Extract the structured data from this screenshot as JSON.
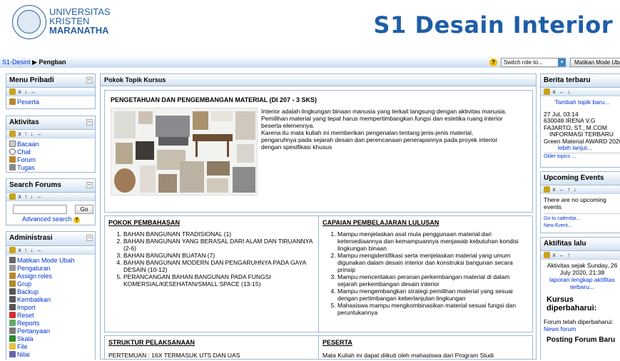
{
  "header": {
    "uni_line1": "UNIVERSITAS",
    "uni_line2": "KRISTEN",
    "uni_line3": "MARANATHA",
    "site_title": "S1 Desain Interior"
  },
  "breadcrumb": {
    "home": "S1-Desint",
    "arrow": "▶",
    "current": "Pengban"
  },
  "nav": {
    "help": "?",
    "role_select": "Switch role to...",
    "edit_button": "Matikan Mode Ubah"
  },
  "left": {
    "menu_pribadi": {
      "title": "Menu Pribadi",
      "items": [
        "Peserta"
      ]
    },
    "aktivitas": {
      "title": "Aktivitas",
      "items": [
        "Bacaan",
        "Chat",
        "Forum",
        "Tugas"
      ]
    },
    "search": {
      "title": "Search Forums",
      "button": "Go",
      "advanced": "Advanced search"
    },
    "admin": {
      "title": "Administrasi",
      "items": [
        "Matikan Mode Ubah",
        "Pengaturan",
        "Assign roles",
        "Grup",
        "Backup",
        "Kembalikan",
        "Import",
        "Reset",
        "Reports",
        "Pertanyaan",
        "Skala",
        "File",
        "Nilai"
      ]
    }
  },
  "content": {
    "header": "Pokok Topik Kursus",
    "summary_title": "PENGETAHUAN DAN PENGEMBANGAN MATERIAL (DI 207 - 3 SKS)",
    "description": [
      "Interior adalah lingkungan binaan manusia yang terkait langsung dengan aktivitas manusia.",
      "Pemilihan material yang tepat harus mempertimbangkan fungsi dan estetika ruang interior beserta elemennya.",
      "Karena itu mata kuliah ini memberikan pengenalan tentang jenis-jenis material, pengaruhnya pada sejarah desain dan perencanaan penerapannya pada proyek interior dengan spesifikasi khusus"
    ],
    "pokok_title": "POKOK PEMBAHASAN",
    "pokok_items": [
      "BAHAN BANGUNAN TRADISIONAL (1)",
      "BAHAN BANGUNAN YANG BERASAL DARI ALAM DAN TIRUANNYA (2-6)",
      "BAHAN BANGUNAN BUATAN (7)",
      "BAHAN BANGUNAN MODERN DAN PENGARUHNYA PADA GAYA DESAIN (10-12)",
      "PERANCANGAN BAHAN BANGUNAN PADA FUNGSI KOMERSIAL/KESEHATAN/SMALL SPACE (13-15)"
    ],
    "capaian_title": "CAPAIAN PEMBELAJARAN LULUSAN",
    "capaian_items": [
      "Mampu menjelaskan asal mula penggunaan material dari ketersediaannya dan kemampuannya menjawab kebutuhan kondisi lingkungan binaan",
      "Mampu mengidentifikasi serta menjelaskan material yang umum digunakan dalam desain interior dan konstruksi bangunan secara prinsip",
      "Mampu menceritakan peranan perkembangan material di dalam sejarah perkembangan desain interior",
      "Mampu mengembangkan strategi pemilihan material yang sesuai dengan pertimbangan keberlanjutan lingkungan",
      "Mahasiswa mampu mengkombinasikan material sesuai fungsi dan peruntukannya"
    ],
    "struktur_title": "STRUKTUR PELAKSANAAN",
    "struktur_text": "PERTEMUAN : 16X TERMASUK UTS DAN UAS",
    "peserta_title": "PESERTA",
    "peserta_text": "Mata Kuliah ini dapat diikuti oleh mahasiswa dari Program Studi"
  },
  "right": {
    "berita": {
      "title": "Berita terbaru",
      "add": "Tambah topik baru...",
      "date": "27 Jul, 03:14",
      "author_line1": "630048 IRENA V.G",
      "author_line2": "FAJARTO, ST., M.COM",
      "news_line1": "INFORMASI TERBARU",
      "news_line2": "Green Material AWARD 2020",
      "more": "lebih lanjut...",
      "older": "Older topics ..."
    },
    "events": {
      "title": "Upcoming Events",
      "empty": "There are no upcoming events",
      "calendar": "Go to calendar...",
      "new_event": "New Event..."
    },
    "aktifitas": {
      "title": "Aktifitas lalu",
      "since_line1": "Aktivitas sejak Sunday, 26",
      "since_line2": "July 2020, 21:38",
      "report_line1": "laporan lengkap aktifitas",
      "report_line2": "terbaru...",
      "kursus_title": "Kursus diperbaharui:",
      "forum_updated": "Forum telah diperbaharui:",
      "news_forum": "News forum",
      "posting_title": "Posting Forum Baru"
    }
  }
}
